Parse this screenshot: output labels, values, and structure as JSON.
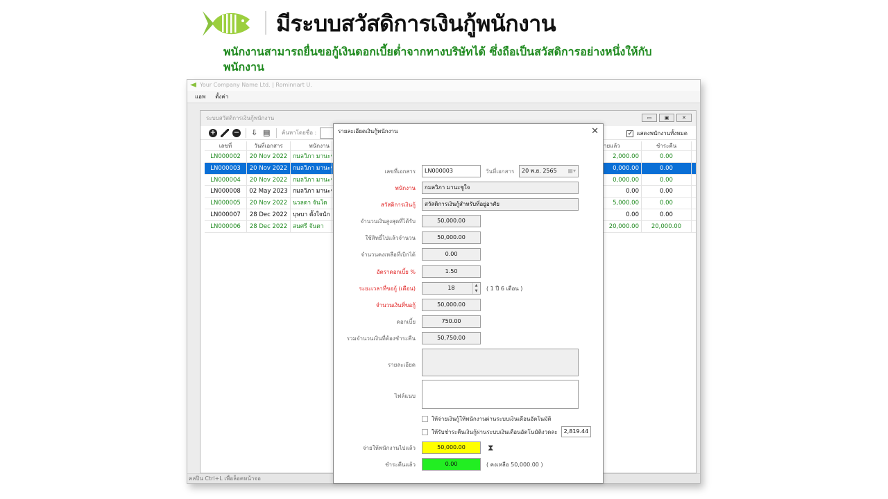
{
  "hero": {
    "title": "มีระบบสวัสดิการเงินกู้พนักงาน",
    "subtitle": "พนักงานสามารถยื่นขอกู้เงินดอกเบี้ยต่ำจากทางบริษัทได้   ซึ่งถือเป็นสวัสดิการอย่างหนึ่งให้กับพนักงาน"
  },
  "app": {
    "title": "Your Company Name Ltd. | Rominnart U.",
    "menu": [
      "แอพ",
      "ตั้งค่า"
    ],
    "status": "คลปิ่น Ctrl+L เพื่อล็อคหน้าจอ"
  },
  "child": {
    "title": "ระบบสวัสดิการเงินกู้พนักงาน",
    "search_label": "ค้นหาโดยชื่อ :",
    "search_value": "",
    "show_all": "แสดงพนักงานทั้งหมด",
    "show_all_checked": "✓"
  },
  "table": {
    "headers": [
      "เลขที่",
      "วันที่เอกสาร",
      "พนักงาน",
      "ายแล้ว",
      "ชำระคืน"
    ],
    "rows": [
      {
        "no": "LN000002",
        "date": "20 Nov 2022",
        "name": "กมลวิภา มานะชูใจ",
        "paid": "2,000.00",
        "returned": "0.00",
        "style": "green"
      },
      {
        "no": "LN000003",
        "date": "20 Nov 2022",
        "name": "กมลวิภา มานะชูใจ",
        "paid": "0,000.00",
        "returned": "0.00",
        "style": "sel"
      },
      {
        "no": "LN000004",
        "date": "20 Nov 2022",
        "name": "กมลวิภา มานะชูใจ",
        "paid": "0,000.00",
        "returned": "0.00",
        "style": "green"
      },
      {
        "no": "LN000008",
        "date": "02 May 2023",
        "name": "กมลวิภา มานะชูใจ",
        "paid": "0.00",
        "returned": "0.00",
        "style": "black"
      },
      {
        "no": "LN000005",
        "date": "20 Nov 2022",
        "name": "นวลดา จันโด",
        "paid": "5,000.00",
        "returned": "0.00",
        "style": "green"
      },
      {
        "no": "LN000007",
        "date": "28 Dec 2022",
        "name": "บุษบา ตั้งใจนัก",
        "paid": "0.00",
        "returned": "0.00",
        "style": "black"
      },
      {
        "no": "LN000006",
        "date": "28 Dec 2022",
        "name": "สมศรี จันดา",
        "paid": "20,000.00",
        "returned": "20,000.00",
        "style": "green"
      }
    ]
  },
  "dialog": {
    "title": "รายละเอียดเงินกู้พนักงาน",
    "ghost_text": "",
    "doc_no_label": "เลขที่เอกสาร",
    "doc_no": "LN000003",
    "doc_date_label": "วันที่เอกสาร",
    "doc_date": "20 พ.ย.  2565",
    "employee_label": "พนักงาน",
    "employee": "กมลวิภา มานะชูใจ",
    "welfare_label": "สวัสดิการเงินกู้",
    "welfare": "สวัสดิการเงินกู้สำหรับที่อยู่อาศัย",
    "max_label": "จำนวนเงินสูงสุดที่ได้รับ",
    "max": "50,000.00",
    "used_label": "ใช้สิทธิ์ไปแล้วจำนวน",
    "used": "50,000.00",
    "remain_label": "จำนวนคงเหลือที่เบิกได้",
    "remain": "0.00",
    "rate_label": "อัตราดอกเบี้ย %",
    "rate": "1.50",
    "period_label": "ระยะเวลาที่ขอกู้ (เดือน)",
    "period": "18",
    "period_note": "( 1 ปี 6 เดือน )",
    "amount_label": "จำนวนเงินที่ขอกู้",
    "amount": "50,000.00",
    "interest_label": "ดอกเบี้ย",
    "interest": "750.00",
    "total_label": "รวมจำนวนเงินที่ต้องชำระคืน",
    "total": "50,750.00",
    "detail_label": "รายละเอียด",
    "attach_label": "ไฟล์แนบ",
    "check1": "ให้จ่ายเงินกู้ให้พนักงานผ่านระบบเงินเดือนอัตโนมัติ",
    "check2": "ให้รับชำระคืนเงินกู้ผ่านระบบเงินเดือนอัตโนมัติงวดละ",
    "installment": "2,819.44",
    "paid_label": "จ่ายให้พนักงานไปแล้ว",
    "paid": "50,000.00",
    "returned_label": "ชำระคืนแล้ว",
    "returned": "0.00",
    "remaining_note": "( คงเหลือ 50,000.00 )"
  },
  "colors": {
    "accent": "#8ac23e",
    "required": "#e02020",
    "selection": "#0a6fd6",
    "paid_highlight": "#ffff00",
    "returned_highlight": "#22ee22"
  },
  "icons": [
    "fish-logo-icon",
    "add-icon",
    "edit-icon",
    "remove-icon",
    "transfer-icon",
    "report-icon",
    "close-icon",
    "calendar-icon",
    "hourglass-icon"
  ]
}
